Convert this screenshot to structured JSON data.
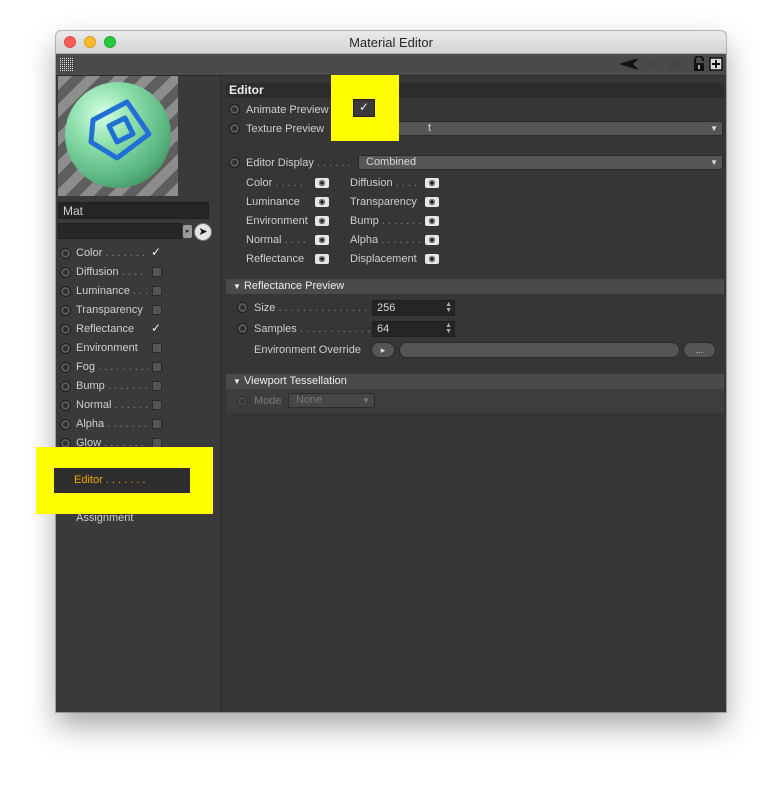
{
  "window": {
    "title": "Material Editor"
  },
  "toolbar": {
    "icons": [
      "texture-grid-icon",
      "back-arrow-icon",
      "forward-arrow-icon",
      "home-icon",
      "lock-icon",
      "new-window-icon"
    ]
  },
  "material": {
    "name": "Mat"
  },
  "channels": [
    {
      "label": "Color",
      "dots": ". . . . . . .",
      "checked": true
    },
    {
      "label": "Diffusion",
      "dots": ". . . .",
      "checked": false
    },
    {
      "label": "Luminance",
      "dots": ". . .",
      "checked": false
    },
    {
      "label": "Transparency",
      "dots": "",
      "checked": false
    },
    {
      "label": "Reflectance",
      "dots": "",
      "checked": true
    },
    {
      "label": "Environment",
      "dots": "",
      "checked": false
    },
    {
      "label": "Fog",
      "dots": ". . . . . . . . .",
      "checked": false
    },
    {
      "label": "Bump",
      "dots": ". . . . . . .",
      "checked": false
    },
    {
      "label": "Normal",
      "dots": ". . . . . .",
      "checked": false
    },
    {
      "label": "Alpha",
      "dots": ". . . . . . .",
      "checked": false
    },
    {
      "label": "Glow",
      "dots": ". . . . . . .",
      "checked": false
    }
  ],
  "editor_item": {
    "label": "Editor",
    "dots": ". . . . . . ."
  },
  "assignment_item": {
    "label": "Assignment"
  },
  "editor": {
    "header": "Editor",
    "animate_preview": {
      "label": "Animate Preview",
      "checked": true
    },
    "texture_preview": {
      "label": "Texture Preview",
      "value": "t"
    },
    "editor_display": {
      "label": "Editor Display",
      "dots": ". . . . . .",
      "value": "Combined"
    },
    "channels_left": [
      "Color",
      "Luminance",
      "Environment",
      "Normal",
      "Reflectance"
    ],
    "channels_left_dots": [
      ". . . . .",
      "",
      "",
      ". . . .",
      ""
    ],
    "channels_right": [
      "Diffusion",
      "Transparency",
      "Bump",
      "Alpha",
      "Displacement"
    ],
    "channels_right_dots": [
      ". . . .",
      "",
      ". . . . . . .",
      ". . . . . . .",
      ""
    ]
  },
  "reflectance_preview": {
    "header": "Reflectance Preview",
    "size": {
      "label": "Size",
      "dots": ". . . . . . . . . . . . . . .",
      "value": "256"
    },
    "samples": {
      "label": "Samples",
      "dots": ". . . . . . . . . . . .",
      "value": "64"
    },
    "env_override": {
      "label": "Environment Override",
      "button": "..."
    }
  },
  "viewport_tessellation": {
    "header": "Viewport Tessellation",
    "mode": {
      "label": "Mode",
      "value": "None"
    }
  },
  "colors": {
    "highlight": "#ffff00",
    "active": "#f7a400",
    "panel": "#363636"
  }
}
